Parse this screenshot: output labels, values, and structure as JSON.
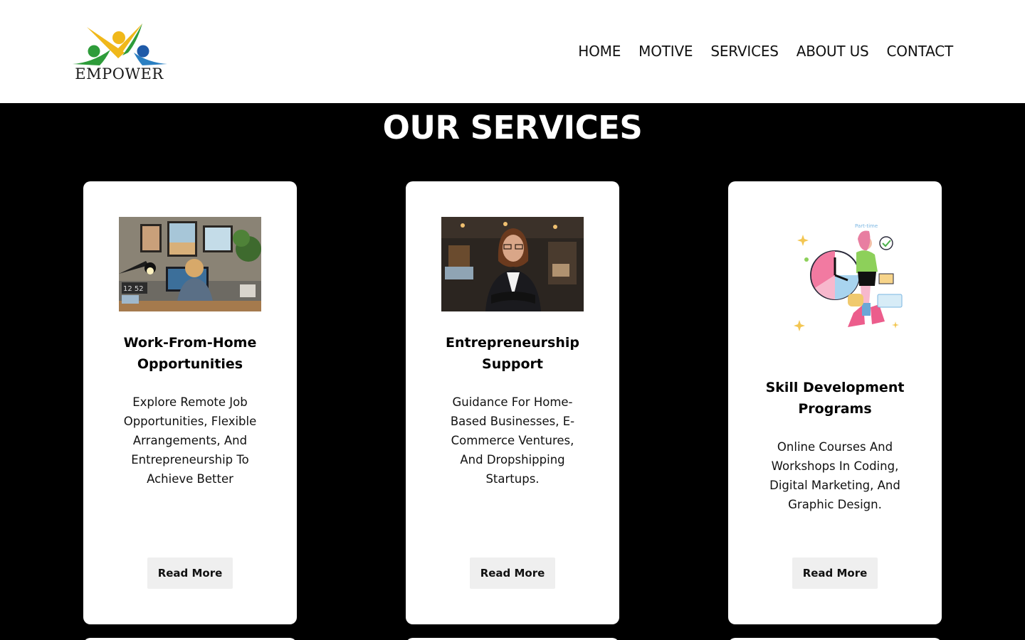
{
  "header": {
    "logo_text": "EMPOWER",
    "nav": [
      "HOME",
      "MOTIVE",
      "SERVICES",
      "ABOUT US",
      "CONTACT"
    ]
  },
  "section": {
    "title": "OUR SERVICES"
  },
  "cards": [
    {
      "title": "Work-From-Home Opportunities",
      "description": "Explore Remote Job Opportunities, Flexible Arrangements, And Entrepreneurship To Achieve Better",
      "button": "Read More",
      "image": "home-office-photo",
      "image_text": "12 52"
    },
    {
      "title": "Entrepreneurship Support",
      "description": "Guidance For Home-Based Businesses, E-Commerce Ventures, And Dropshipping Startups.",
      "button": "Read More",
      "image": "businesswoman-photo"
    },
    {
      "title": "Skill Development Programs",
      "description": "Online Courses And Workshops In Coding, Digital Marketing, And Graphic Design.",
      "button": "Read More",
      "image": "part-time-illustration",
      "image_text": "Part-time"
    }
  ]
}
